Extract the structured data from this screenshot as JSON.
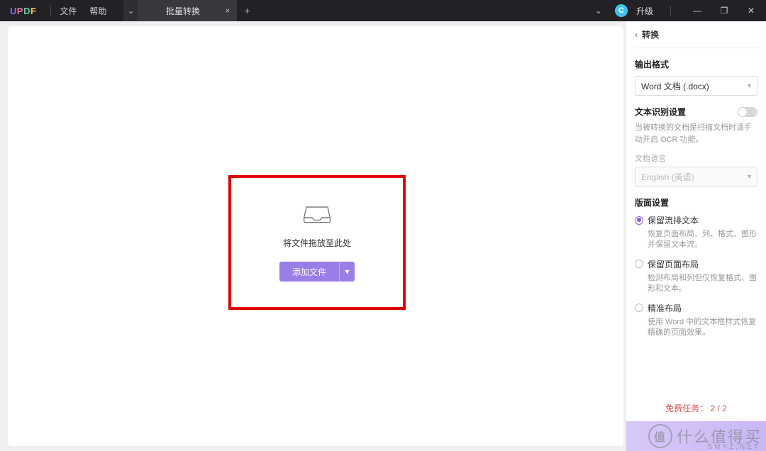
{
  "app": {
    "logo_text": "UPDF"
  },
  "menus": {
    "file": "文件",
    "help": "帮助"
  },
  "tabs": {
    "active": {
      "label": "批量转换"
    },
    "dropdown_glyph": "⌄",
    "close_glyph": "×",
    "add_glyph": "+"
  },
  "titlebar": {
    "avatar_letter": "C",
    "upgrade": "升级",
    "min_glyph": "—",
    "restore_glyph": "❐",
    "close_glyph": "✕"
  },
  "dropzone": {
    "text": "将文件拖放至此处",
    "button": "添加文件",
    "button_caret": "▾"
  },
  "panel": {
    "title": "转换",
    "back_glyph": "‹",
    "output_format": {
      "title": "输出格式",
      "selected": "Word 文档 (.docx)"
    },
    "ocr": {
      "title": "文本识别设置",
      "hint": "当被转换的文档是扫描文档时请手动开启 OCR 功能。",
      "lang_label": "文档语言",
      "lang_selected": "English (英语)"
    },
    "layout": {
      "title": "版面设置",
      "opts": [
        {
          "label": "保留流排文本",
          "desc": "恢复页面布局、列、格式、图形并保留文本流。",
          "checked": true
        },
        {
          "label": "保留页面布局",
          "desc": "检测布局和列但仅恢复格式、图形和文本。",
          "checked": false
        },
        {
          "label": "精准布局",
          "desc": "使用 Word 中的文本框样式恢复精确的页面效果。",
          "checked": false
        }
      ]
    },
    "free_tasks": {
      "label": "免费任务：",
      "count": "2 / 2"
    }
  },
  "watermark": {
    "text": "什么值得买",
    "badge": "值",
    "sub": "SMYZ.NET"
  }
}
